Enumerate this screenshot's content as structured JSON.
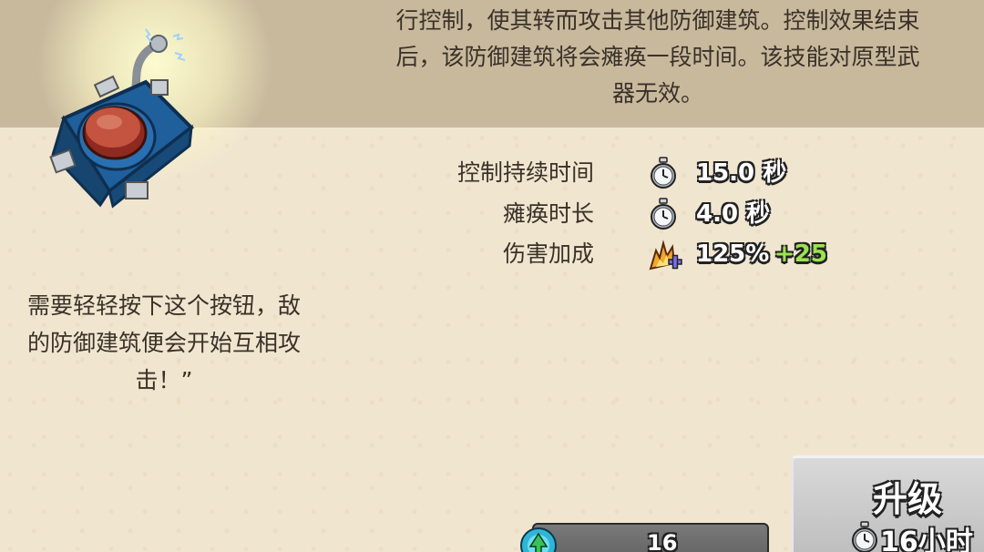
{
  "description": {
    "lines": [
      "行控制，使其转而攻击其他防御建筑。控制效果结束",
      "后，该防御建筑将会瘫痪一段时间。该技能对原型武",
      "器无效。"
    ]
  },
  "item": {
    "icon": "control-button-device-icon"
  },
  "quote": {
    "lines": [
      "需要轻轻按下这个按钮，敌",
      "的防御建筑便会开始互相攻",
      "击！”"
    ]
  },
  "stats": [
    {
      "label": "控制持续时间",
      "icon": "stopwatch-icon",
      "value": "15.0 秒",
      "bonus": ""
    },
    {
      "label": "瘫痪时长",
      "icon": "stopwatch-icon",
      "value": "4.0 秒",
      "bonus": ""
    },
    {
      "label": "伤害加成",
      "icon": "damage-boost-icon",
      "value": "125%",
      "bonus": "+25"
    }
  ],
  "buttons": {
    "gem_count": "16",
    "upgrade_label": "升级",
    "upgrade_time": "16小时"
  },
  "colors": {
    "bonus": "#9be34f",
    "band": "#c8b99d",
    "parchment": "#f0e6d0"
  }
}
